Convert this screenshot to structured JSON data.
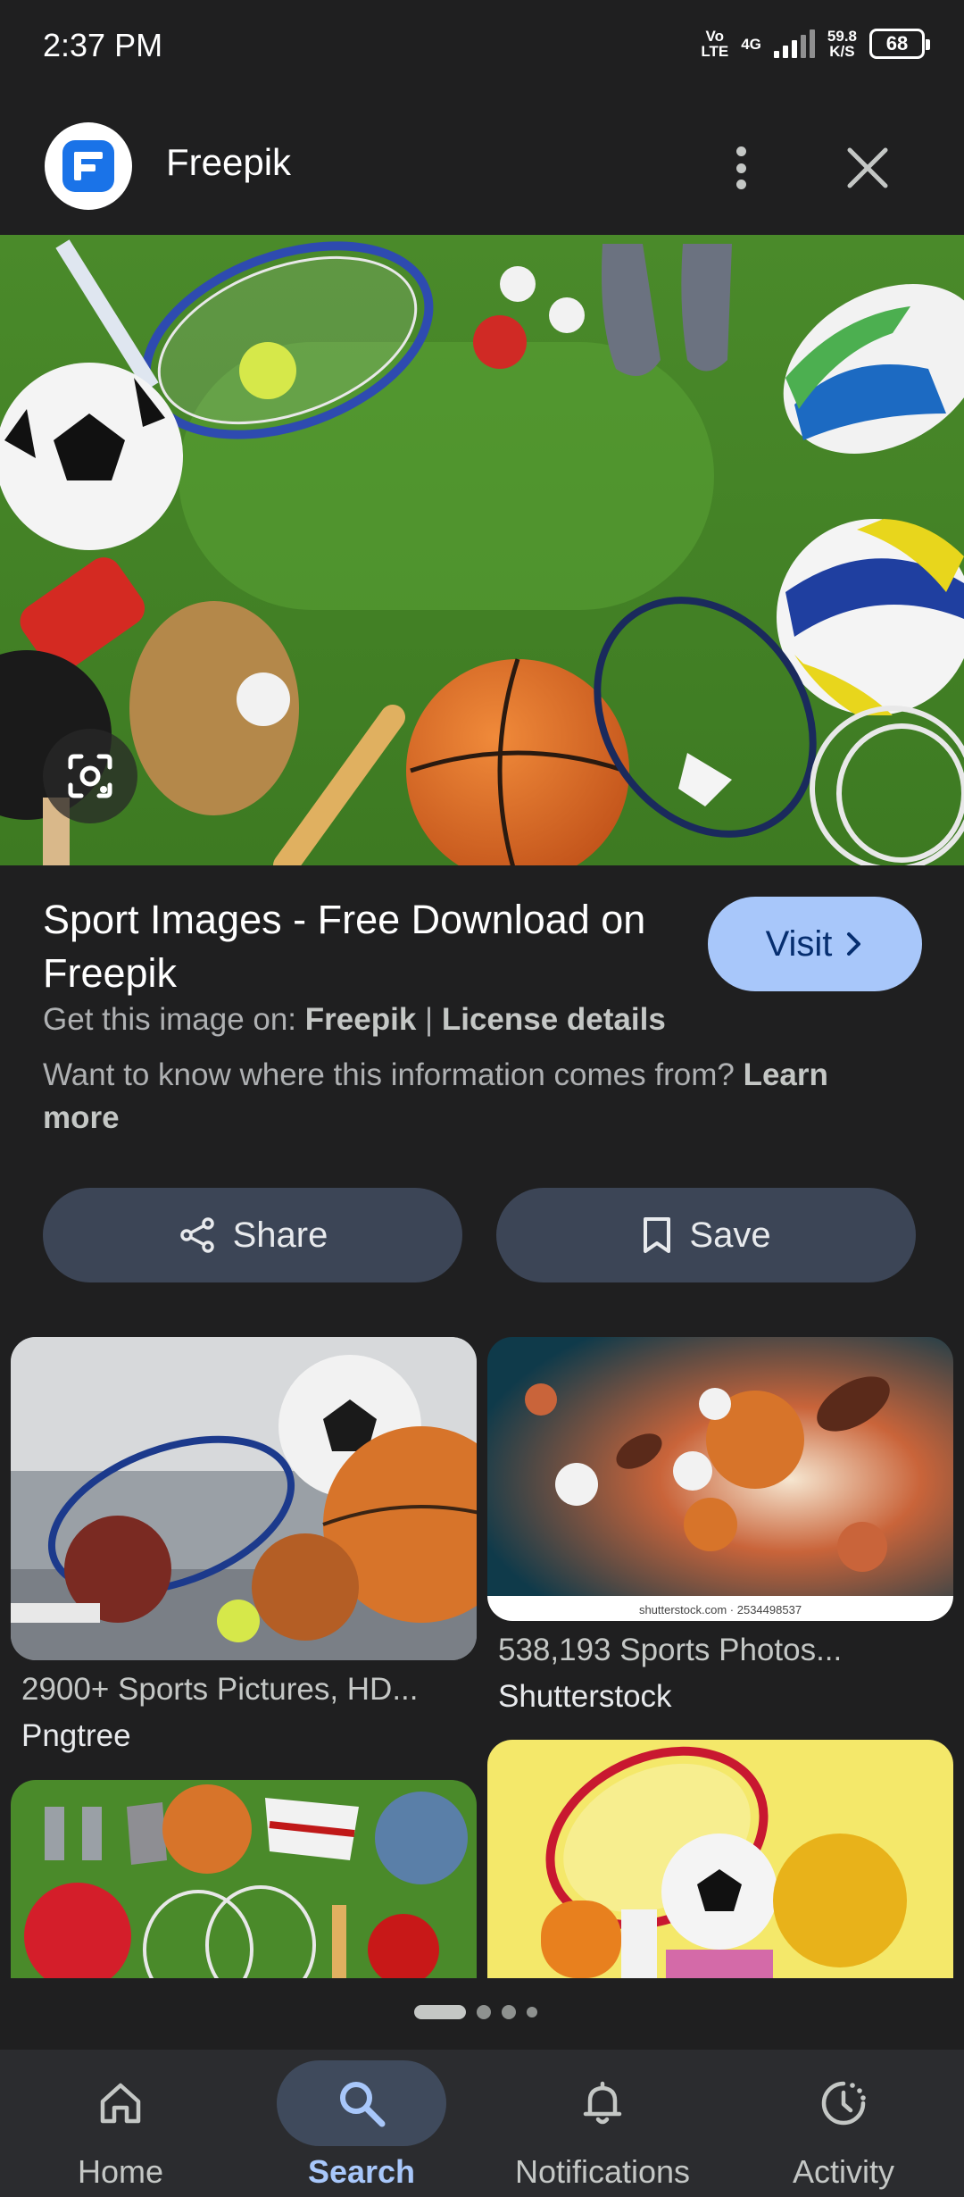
{
  "status_bar": {
    "time": "2:37 PM",
    "volte_top": "Vo",
    "volte_bottom": "LTE",
    "network": "4G",
    "speed_value": "59.8",
    "speed_unit": "K/S",
    "battery": "68"
  },
  "header": {
    "site_name": "Freepik"
  },
  "result": {
    "title": "Sport Images - Free Download on Freepik",
    "visit_label": "Visit",
    "source_prefix": "Get this image on:",
    "source_name": "Freepik",
    "separator": "|",
    "license_label": "License details",
    "info_text": "Want to know where this information comes from?",
    "learn_more": "Learn more"
  },
  "actions": {
    "share_label": "Share",
    "save_label": "Save"
  },
  "related": [
    {
      "caption": "2900+ Sports Pictures, HD...",
      "source": "Pngtree"
    },
    {
      "caption": "538,193 Sports Photos...",
      "source": "Shutterstock",
      "watermark": "shutterstock.com · 2534498537"
    }
  ],
  "bottom_nav": {
    "items": [
      {
        "label": "Home",
        "icon": "home-icon"
      },
      {
        "label": "Search",
        "icon": "search-icon"
      },
      {
        "label": "Notifications",
        "icon": "bell-icon"
      },
      {
        "label": "Activity",
        "icon": "activity-icon"
      }
    ]
  },
  "colors": {
    "background": "#1f1f20",
    "accent": "#a8c7fa",
    "button_bg": "#3c4556",
    "nav_bg": "#2b2c2f"
  }
}
